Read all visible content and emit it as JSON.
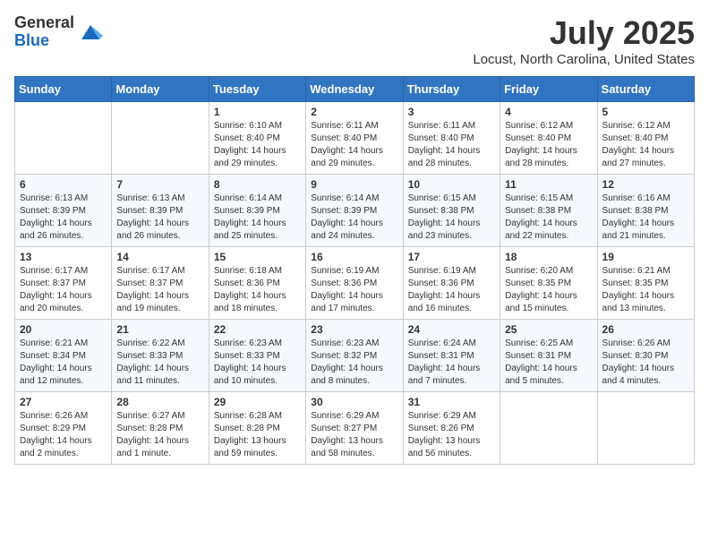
{
  "header": {
    "logo_general": "General",
    "logo_blue": "Blue",
    "month_title": "July 2025",
    "location": "Locust, North Carolina, United States"
  },
  "days_of_week": [
    "Sunday",
    "Monday",
    "Tuesday",
    "Wednesday",
    "Thursday",
    "Friday",
    "Saturday"
  ],
  "weeks": [
    [
      {
        "day": "",
        "sunrise": "",
        "sunset": "",
        "daylight": ""
      },
      {
        "day": "",
        "sunrise": "",
        "sunset": "",
        "daylight": ""
      },
      {
        "day": "1",
        "sunrise": "Sunrise: 6:10 AM",
        "sunset": "Sunset: 8:40 PM",
        "daylight": "Daylight: 14 hours and 29 minutes."
      },
      {
        "day": "2",
        "sunrise": "Sunrise: 6:11 AM",
        "sunset": "Sunset: 8:40 PM",
        "daylight": "Daylight: 14 hours and 29 minutes."
      },
      {
        "day": "3",
        "sunrise": "Sunrise: 6:11 AM",
        "sunset": "Sunset: 8:40 PM",
        "daylight": "Daylight: 14 hours and 28 minutes."
      },
      {
        "day": "4",
        "sunrise": "Sunrise: 6:12 AM",
        "sunset": "Sunset: 8:40 PM",
        "daylight": "Daylight: 14 hours and 28 minutes."
      },
      {
        "day": "5",
        "sunrise": "Sunrise: 6:12 AM",
        "sunset": "Sunset: 8:40 PM",
        "daylight": "Daylight: 14 hours and 27 minutes."
      }
    ],
    [
      {
        "day": "6",
        "sunrise": "Sunrise: 6:13 AM",
        "sunset": "Sunset: 8:39 PM",
        "daylight": "Daylight: 14 hours and 26 minutes."
      },
      {
        "day": "7",
        "sunrise": "Sunrise: 6:13 AM",
        "sunset": "Sunset: 8:39 PM",
        "daylight": "Daylight: 14 hours and 26 minutes."
      },
      {
        "day": "8",
        "sunrise": "Sunrise: 6:14 AM",
        "sunset": "Sunset: 8:39 PM",
        "daylight": "Daylight: 14 hours and 25 minutes."
      },
      {
        "day": "9",
        "sunrise": "Sunrise: 6:14 AM",
        "sunset": "Sunset: 8:39 PM",
        "daylight": "Daylight: 14 hours and 24 minutes."
      },
      {
        "day": "10",
        "sunrise": "Sunrise: 6:15 AM",
        "sunset": "Sunset: 8:38 PM",
        "daylight": "Daylight: 14 hours and 23 minutes."
      },
      {
        "day": "11",
        "sunrise": "Sunrise: 6:15 AM",
        "sunset": "Sunset: 8:38 PM",
        "daylight": "Daylight: 14 hours and 22 minutes."
      },
      {
        "day": "12",
        "sunrise": "Sunrise: 6:16 AM",
        "sunset": "Sunset: 8:38 PM",
        "daylight": "Daylight: 14 hours and 21 minutes."
      }
    ],
    [
      {
        "day": "13",
        "sunrise": "Sunrise: 6:17 AM",
        "sunset": "Sunset: 8:37 PM",
        "daylight": "Daylight: 14 hours and 20 minutes."
      },
      {
        "day": "14",
        "sunrise": "Sunrise: 6:17 AM",
        "sunset": "Sunset: 8:37 PM",
        "daylight": "Daylight: 14 hours and 19 minutes."
      },
      {
        "day": "15",
        "sunrise": "Sunrise: 6:18 AM",
        "sunset": "Sunset: 8:36 PM",
        "daylight": "Daylight: 14 hours and 18 minutes."
      },
      {
        "day": "16",
        "sunrise": "Sunrise: 6:19 AM",
        "sunset": "Sunset: 8:36 PM",
        "daylight": "Daylight: 14 hours and 17 minutes."
      },
      {
        "day": "17",
        "sunrise": "Sunrise: 6:19 AM",
        "sunset": "Sunset: 8:36 PM",
        "daylight": "Daylight: 14 hours and 16 minutes."
      },
      {
        "day": "18",
        "sunrise": "Sunrise: 6:20 AM",
        "sunset": "Sunset: 8:35 PM",
        "daylight": "Daylight: 14 hours and 15 minutes."
      },
      {
        "day": "19",
        "sunrise": "Sunrise: 6:21 AM",
        "sunset": "Sunset: 8:35 PM",
        "daylight": "Daylight: 14 hours and 13 minutes."
      }
    ],
    [
      {
        "day": "20",
        "sunrise": "Sunrise: 6:21 AM",
        "sunset": "Sunset: 8:34 PM",
        "daylight": "Daylight: 14 hours and 12 minutes."
      },
      {
        "day": "21",
        "sunrise": "Sunrise: 6:22 AM",
        "sunset": "Sunset: 8:33 PM",
        "daylight": "Daylight: 14 hours and 11 minutes."
      },
      {
        "day": "22",
        "sunrise": "Sunrise: 6:23 AM",
        "sunset": "Sunset: 8:33 PM",
        "daylight": "Daylight: 14 hours and 10 minutes."
      },
      {
        "day": "23",
        "sunrise": "Sunrise: 6:23 AM",
        "sunset": "Sunset: 8:32 PM",
        "daylight": "Daylight: 14 hours and 8 minutes."
      },
      {
        "day": "24",
        "sunrise": "Sunrise: 6:24 AM",
        "sunset": "Sunset: 8:31 PM",
        "daylight": "Daylight: 14 hours and 7 minutes."
      },
      {
        "day": "25",
        "sunrise": "Sunrise: 6:25 AM",
        "sunset": "Sunset: 8:31 PM",
        "daylight": "Daylight: 14 hours and 5 minutes."
      },
      {
        "day": "26",
        "sunrise": "Sunrise: 6:26 AM",
        "sunset": "Sunset: 8:30 PM",
        "daylight": "Daylight: 14 hours and 4 minutes."
      }
    ],
    [
      {
        "day": "27",
        "sunrise": "Sunrise: 6:26 AM",
        "sunset": "Sunset: 8:29 PM",
        "daylight": "Daylight: 14 hours and 2 minutes."
      },
      {
        "day": "28",
        "sunrise": "Sunrise: 6:27 AM",
        "sunset": "Sunset: 8:28 PM",
        "daylight": "Daylight: 14 hours and 1 minute."
      },
      {
        "day": "29",
        "sunrise": "Sunrise: 6:28 AM",
        "sunset": "Sunset: 8:28 PM",
        "daylight": "Daylight: 13 hours and 59 minutes."
      },
      {
        "day": "30",
        "sunrise": "Sunrise: 6:29 AM",
        "sunset": "Sunset: 8:27 PM",
        "daylight": "Daylight: 13 hours and 58 minutes."
      },
      {
        "day": "31",
        "sunrise": "Sunrise: 6:29 AM",
        "sunset": "Sunset: 8:26 PM",
        "daylight": "Daylight: 13 hours and 56 minutes."
      },
      {
        "day": "",
        "sunrise": "",
        "sunset": "",
        "daylight": ""
      },
      {
        "day": "",
        "sunrise": "",
        "sunset": "",
        "daylight": ""
      }
    ]
  ]
}
